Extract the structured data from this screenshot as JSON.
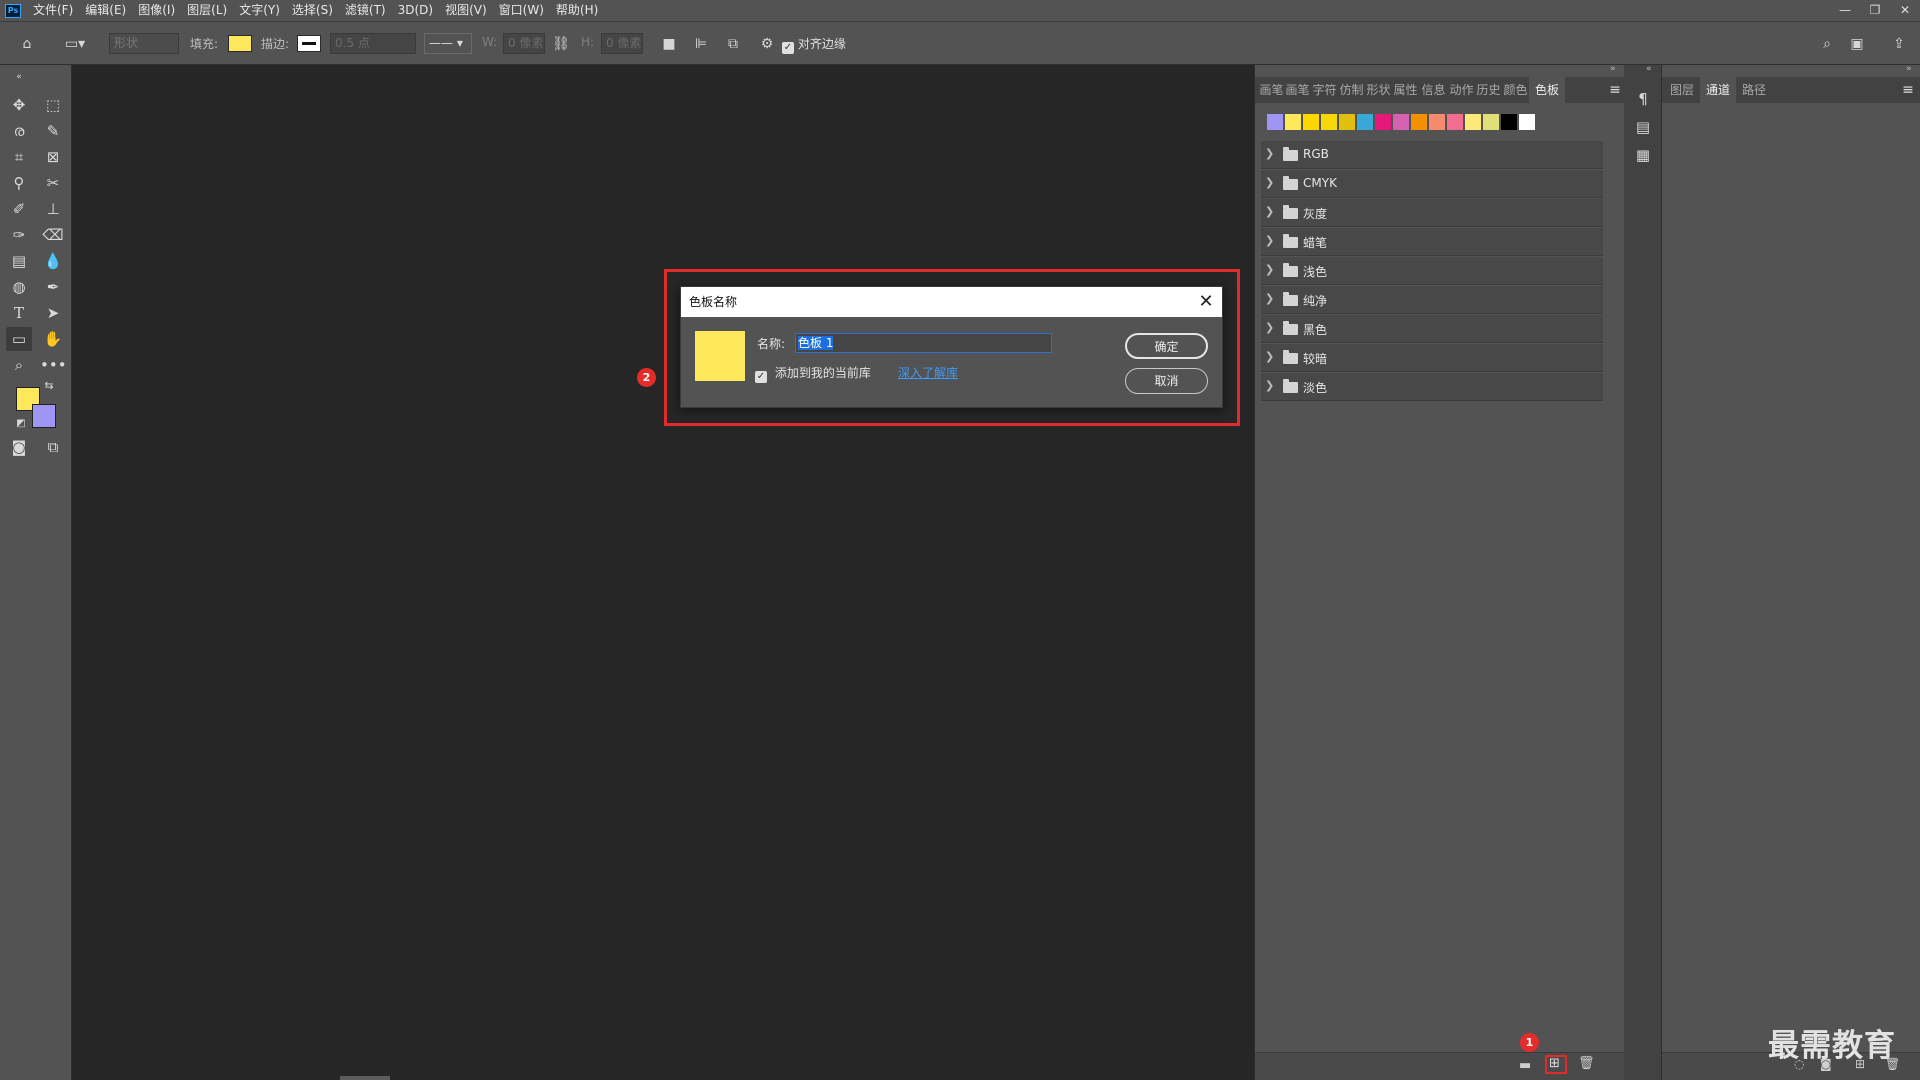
{
  "app_logo": "Ps",
  "menu": [
    "文件(F)",
    "编辑(E)",
    "图像(I)",
    "图层(L)",
    "文字(Y)",
    "选择(S)",
    "滤镜(T)",
    "3D(D)",
    "视图(V)",
    "窗口(W)",
    "帮助(H)"
  ],
  "window_controls": [
    "—",
    "❐",
    "✕"
  ],
  "options": {
    "shape_mode": "形状",
    "fill_label": "填充:",
    "stroke_label": "描边:",
    "stroke_width": "0.5 点",
    "w_label": "W:",
    "w_value": "0 像素",
    "h_label": "H:",
    "h_value": "0 像素",
    "align_edges": "对齐边缘",
    "fill_color": "#fde85b"
  },
  "panel1": {
    "tabs": [
      "画笔",
      "画笔",
      "字符",
      "仿制",
      "形状",
      "属性",
      "信息",
      "动作",
      "历史",
      "颜色",
      "色板"
    ],
    "active_tab": "色板",
    "swatches": [
      "#9f95f3",
      "#fde85b",
      "#ffd700",
      "#f6d80a",
      "#e0c00c",
      "#37a8d8",
      "#e5197a",
      "#d462b0",
      "#f29000",
      "#f68a6e",
      "#f36d8f",
      "#fde87a",
      "#e0e07a",
      "#000000",
      "#ffffff"
    ],
    "groups": [
      "RGB",
      "CMYK",
      "灰度",
      "蜡笔",
      "浅色",
      "纯净",
      "黑色",
      "较暗",
      "淡色"
    ]
  },
  "panel3": {
    "tabs": [
      "图层",
      "通道",
      "路径"
    ],
    "active_tab": "通道"
  },
  "dialog": {
    "title": "色板名称",
    "name_label": "名称:",
    "name_value": "色板 1",
    "add_to_library": "添加到我的当前库",
    "learn_link": "深入了解库",
    "ok": "确定",
    "cancel": "取消",
    "preview_color": "#fde85b"
  },
  "colors": {
    "foreground": "#fde85b",
    "background": "#9f95f3",
    "highlight_red": "#e02b2b"
  },
  "badges": [
    "1",
    "2"
  ],
  "watermark": "最需教育"
}
